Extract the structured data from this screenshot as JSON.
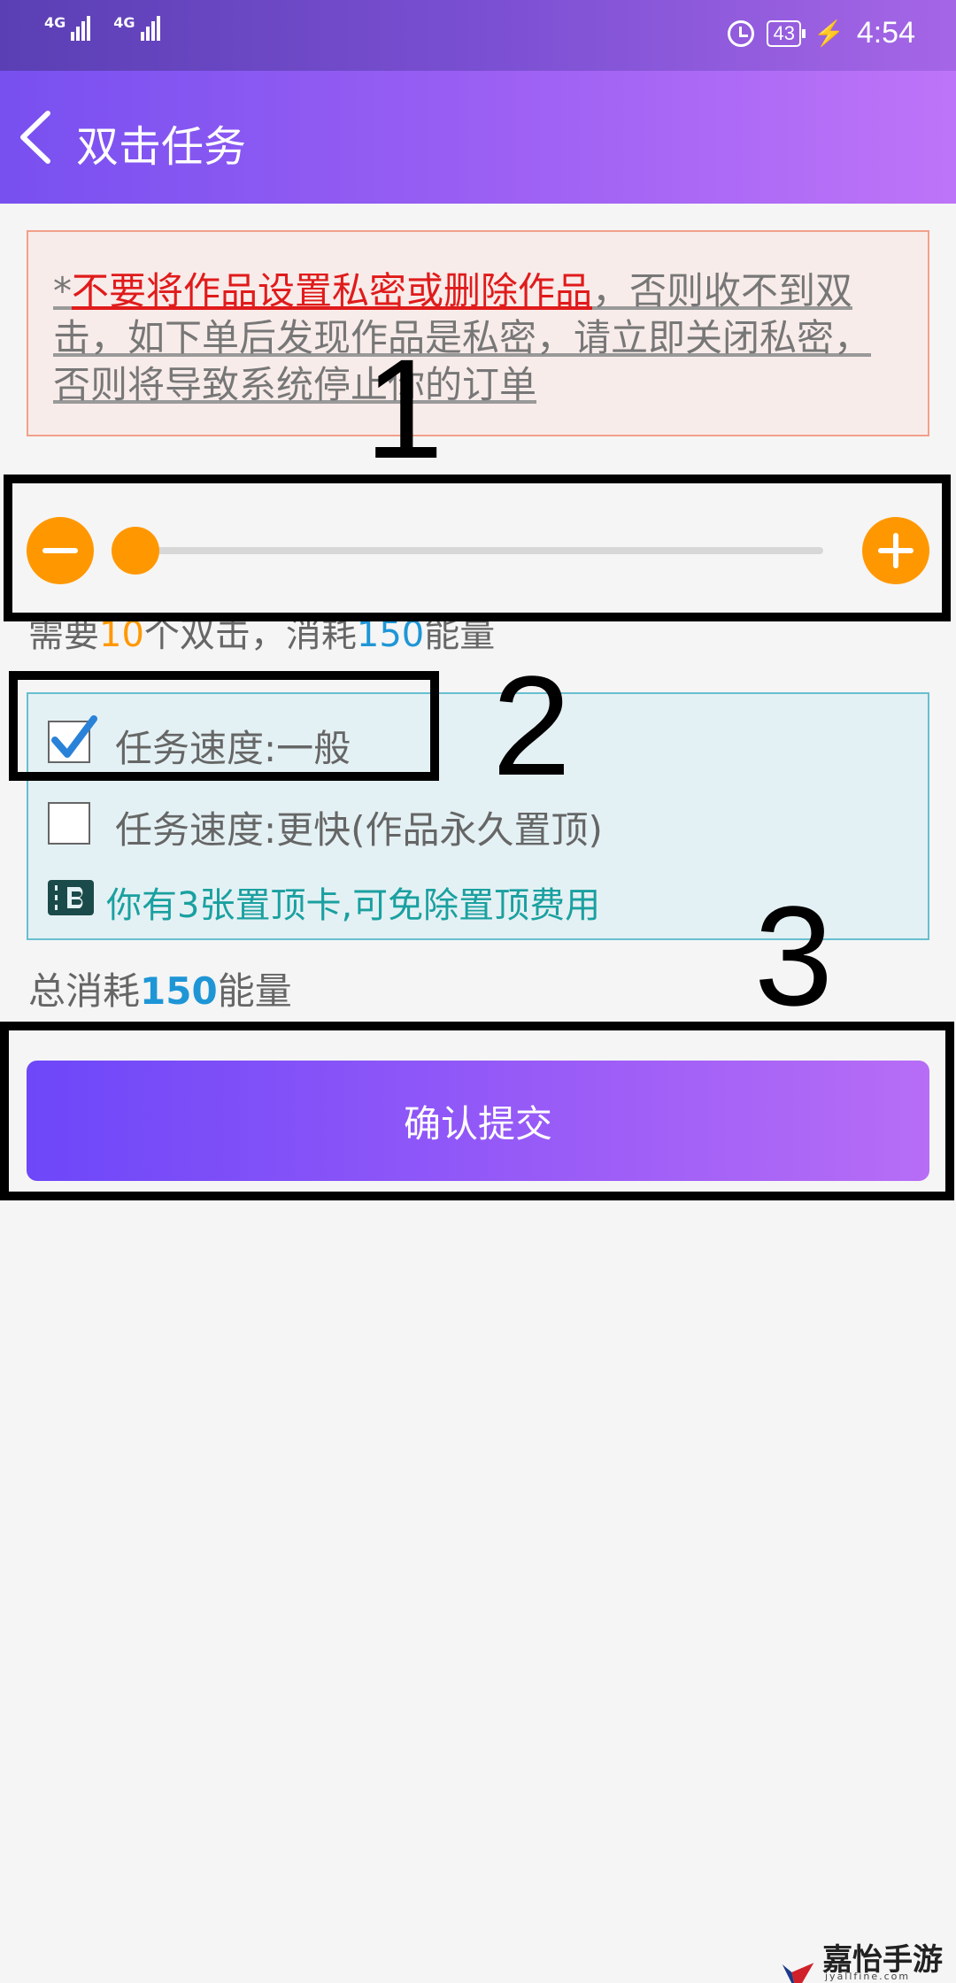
{
  "status_bar": {
    "net1": "4G",
    "net2": "4G",
    "battery": "43",
    "time": "4:54"
  },
  "header": {
    "title": "双击任务"
  },
  "warning": {
    "star": "*",
    "red_text": "不要将作品设置私密或删除作品",
    "rest_text": "，否则收不到双击，如下单后发现作品是私密，请立即关闭私密，否则将导致系统停止你的订单"
  },
  "slider": {
    "value_fraction": 0.0
  },
  "need": {
    "prefix": "需要",
    "count": "10",
    "middle": "个双击，消耗",
    "energy": "150",
    "suffix": "能量"
  },
  "options": {
    "normal_label": "任务速度:一般",
    "normal_checked": true,
    "fast_label": "任务速度:更快(作品永久置顶)",
    "fast_checked": false,
    "card_text": "你有3张置顶卡,可免除置顶费用"
  },
  "total": {
    "prefix": "总消耗",
    "energy": "150",
    "suffix": "能量"
  },
  "submit": {
    "label": "确认提交"
  },
  "annotations": {
    "n1": "1",
    "n2": "2",
    "n3": "3"
  },
  "watermark": {
    "title": "嘉怡手游网",
    "sub": "jyallfine.com"
  },
  "colors": {
    "accent_orange": "#ff9800",
    "accent_blue": "#1e96d6",
    "warning_red": "#e01b1b",
    "header_start": "#7850f0",
    "header_end": "#be74f8"
  }
}
